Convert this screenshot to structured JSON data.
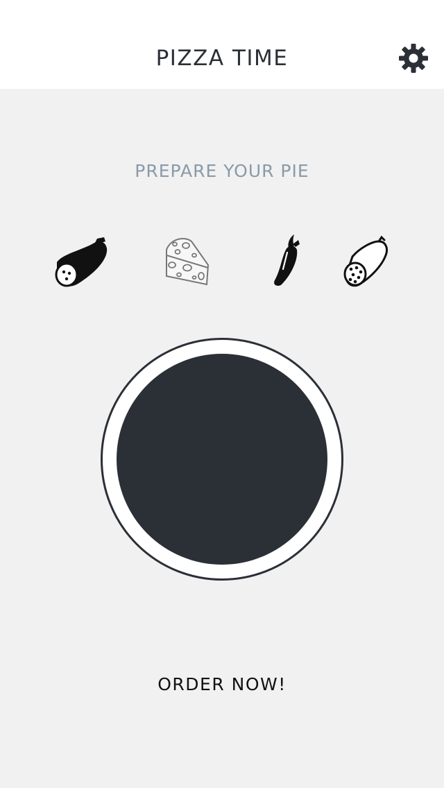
{
  "header": {
    "title": "PIZZA TIME",
    "settings_icon": "gear-icon"
  },
  "main": {
    "subtitle": "PREPARE YOUR PIE",
    "toppings": [
      {
        "icon": "sausage-icon",
        "selected": true
      },
      {
        "icon": "cheese-icon",
        "selected": false
      },
      {
        "icon": "chili-pepper-icon",
        "selected": true
      },
      {
        "icon": "salami-icon",
        "selected": false
      }
    ],
    "pizza": {
      "crust_color": "#ffffff",
      "sauce_color": "#2b2f36"
    },
    "order_label": "ORDER NOW!"
  },
  "colors": {
    "background": "#f1f1f1",
    "header_background": "#ffffff",
    "dark": "#2b2f36",
    "subtitle": "#8a9aa9"
  }
}
